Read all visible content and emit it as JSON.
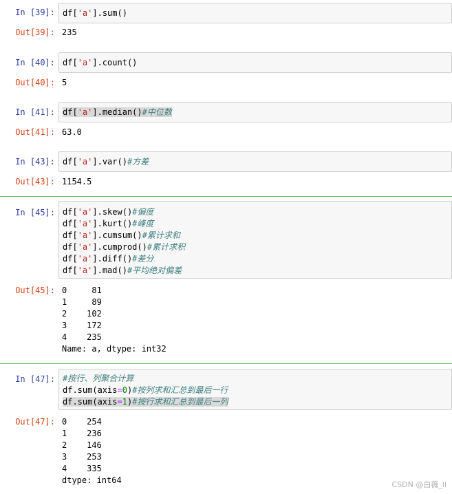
{
  "cells": [
    {
      "in": "In  [39]:",
      "out": "Out[39]:",
      "result": [
        "235"
      ]
    },
    {
      "in": "In  [40]:",
      "out": "Out[40]:",
      "result": [
        "5"
      ]
    },
    {
      "in": "In  [41]:",
      "out": "Out[41]:",
      "comment": "#中位数",
      "result": [
        "63.0"
      ]
    },
    {
      "in": "In  [43]:",
      "out": "Out[43]:",
      "comment": "#方差",
      "result": [
        "1154.5"
      ]
    },
    {
      "in": "In  [45]:",
      "out": "Out[45]:",
      "comments": [
        "#偏度",
        "#峰度",
        "#累计求和",
        "#累计求积",
        "#差分",
        "#平均绝对偏差"
      ],
      "result": [
        "0     81",
        "1     89",
        "2    102",
        "3    172",
        "4    235",
        "Name: a, dtype: int32"
      ]
    },
    {
      "in": "In  [47]:",
      "out": "Out[47]:",
      "comments": [
        "#按行、列聚合计算",
        "#按列求和汇总到最后一行",
        "#按行求和汇总到最后一列"
      ],
      "result": [
        "0    254",
        "1    236",
        "2    146",
        "3    253",
        "4    335",
        "dtype: int64"
      ]
    }
  ],
  "code": {
    "c39": [
      "df['a'].sum()"
    ],
    "c40": [
      "df['a'].count()"
    ],
    "c41": [
      "df['a'].median()"
    ],
    "c43": [
      "df['a'].var()"
    ],
    "c45": [
      "df['a'].skew()",
      "df['a'].kurt()",
      "df['a'].cumsum()",
      "df['a'].cumprod()",
      "df['a'].diff()",
      "df['a'].mad()"
    ],
    "c47": [
      "",
      "df.sum(axis=0)",
      "df.sum(axis=1)"
    ]
  },
  "watermark": "CSDN @白薇_ll",
  "colors": {
    "in_prompt": "#303f9f",
    "out_prompt": "#d84315",
    "string": "#ba2121",
    "comment": "#408080",
    "selected_border": "#66bb6a"
  }
}
